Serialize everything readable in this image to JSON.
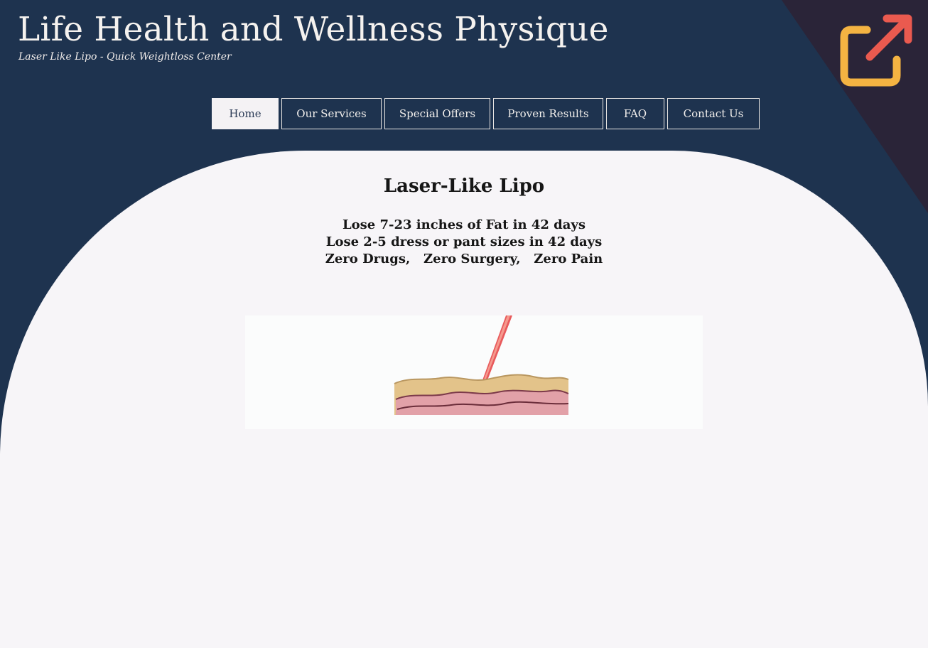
{
  "site": {
    "title": "Life Health and Wellness Physique",
    "tagline": "Laser Like Lipo - Quick Weightloss Center"
  },
  "nav": {
    "items": [
      {
        "label": "Home",
        "active": true
      },
      {
        "label": "Our Services",
        "active": false
      },
      {
        "label": "Special Offers",
        "active": false
      },
      {
        "label": "Proven Results",
        "active": false
      },
      {
        "label": "FAQ",
        "active": false
      },
      {
        "label": "Contact Us",
        "active": false
      }
    ]
  },
  "content": {
    "heading": "Laser-Like Lipo",
    "lines": [
      "Lose 7-23 inches of Fat in 42 days",
      "Lose 2-5 dress or pant sizes in 42 days",
      "Zero Drugs,   Zero Surgery,   Zero Pain"
    ]
  },
  "icons": {
    "external_link": "external-link-icon",
    "illustration": "laser-skin-illustration"
  },
  "colors": {
    "header_bg": "#1e334f",
    "corner_dark": "#2a2438",
    "content_bg": "#f7f5f8",
    "icon_orange": "#f4b342",
    "icon_red": "#ea5a4f"
  }
}
